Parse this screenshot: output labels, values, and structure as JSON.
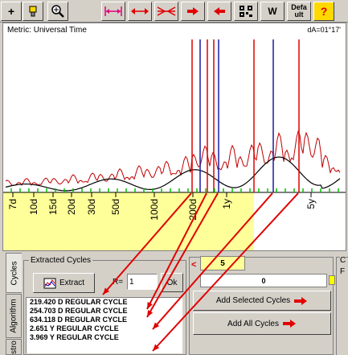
{
  "toolbar": {
    "buttons": [
      {
        "name": "add-icon",
        "glyph": "+"
      },
      {
        "name": "marker-icon",
        "glyph": ""
      },
      {
        "name": "zoom-icon",
        "glyph": ""
      },
      {
        "name": "span-icon",
        "glyph": ""
      },
      {
        "name": "stretch-icon",
        "glyph": ""
      },
      {
        "name": "compress-icon",
        "glyph": ""
      },
      {
        "name": "arrow-right-icon",
        "glyph": ""
      },
      {
        "name": "arrow-left-icon",
        "glyph": ""
      },
      {
        "name": "qr-icon",
        "glyph": ""
      },
      {
        "name": "w-button",
        "glyph": "W"
      },
      {
        "name": "default-button",
        "glyph": "Defa ult"
      },
      {
        "name": "help-button",
        "glyph": "?"
      }
    ]
  },
  "plot": {
    "title": "Metric: Universal Time",
    "da_label": "dA=01°17'",
    "tick_labels": [
      "7d",
      "10d",
      "15d",
      "20d",
      "30d",
      "50d",
      "100d",
      "200d",
      "1y",
      "5y"
    ]
  },
  "tabs": {
    "cycles": "Cycles",
    "algorithm": "Algorithm",
    "astro": "stro"
  },
  "extracted": {
    "group_label": "Extracted Cycles",
    "extract_button": "Extract",
    "r_label": "R=",
    "r_value": "1",
    "ok_label": "Ok",
    "items": [
      "219.420 D REGULAR CYCLE",
      "254.703 D REGULAR CYCLE",
      "634.118 D REGULAR CYCLE",
      "2.651 Y REGULAR CYCLE",
      "3.969 Y REGULAR CYCLE"
    ]
  },
  "right_panel": {
    "lt_symbol": "<",
    "counter_value": "5",
    "progress_value": "0",
    "progress_fraction": 0,
    "add_selected_label": "Add Selected Cycles",
    "add_all_label": "Add All Cycles",
    "frame_label": "C",
    "frame_sub": "F"
  },
  "colors": {
    "spectrum": "#c00000",
    "smooth": "#000000",
    "cycle_line": "#e00000",
    "peak_line": "#1a1aa0",
    "highlight": "#ffff99",
    "progress": "#ffff00",
    "tick_marks": "#00c000"
  }
}
